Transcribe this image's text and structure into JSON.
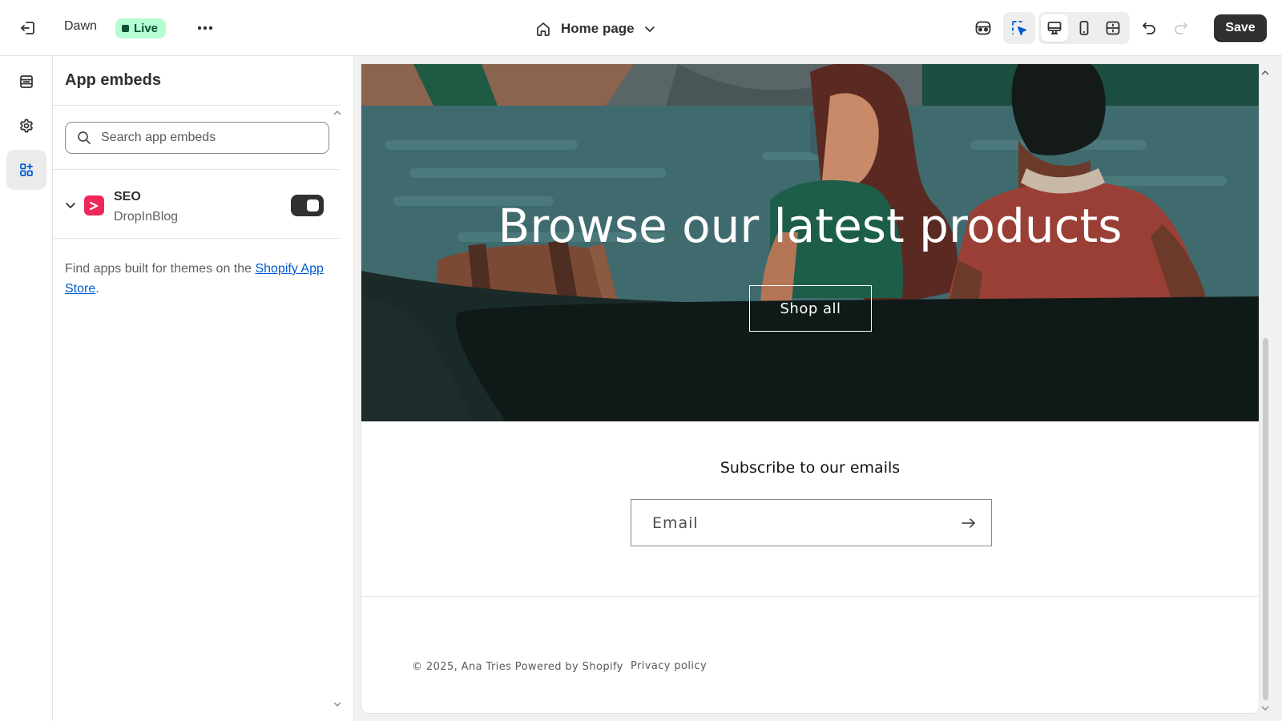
{
  "topbar": {
    "theme_name": "Dawn",
    "status_badge": "Live",
    "page_selector": "Home page",
    "save_label": "Save"
  },
  "panel": {
    "title": "App embeds",
    "search_placeholder": "Search app embeds",
    "embeds": [
      {
        "name": "SEO",
        "app": "DropInBlog",
        "enabled": true
      }
    ],
    "help_text": "Find apps built for themes on the ",
    "help_link": "Shopify App Store",
    "help_end": "."
  },
  "preview": {
    "hero_heading": "Browse our latest products",
    "hero_button": "Shop all",
    "newsletter_title": "Subscribe to our emails",
    "email_placeholder": "Email",
    "footer_copyright": "© 2025, Ana Tries Powered by Shopify",
    "footer_separator": "·",
    "footer_privacy": "Privacy policy"
  },
  "colors": {
    "live_badge_bg": "#b4fed2",
    "save_bg": "#303030",
    "link": "#005bd3",
    "embed_logo": "#f0285a"
  }
}
